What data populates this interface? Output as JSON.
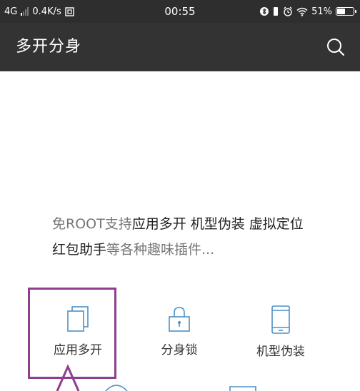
{
  "status_bar": {
    "network": "4G",
    "speed": "0.4K/s",
    "time": "00:55",
    "battery": "51%",
    "battery_level": 0.51,
    "icons": [
      "sim-icon",
      "bluetooth-icon",
      "vibrate-icon",
      "alarm-icon",
      "wifi-icon",
      "battery-icon"
    ]
  },
  "app_bar": {
    "title": "多开分身",
    "search_icon": "search-icon"
  },
  "description": {
    "segments": [
      "免ROOT支持",
      "应用多开 机型伪装 虚拟定位 红包助手",
      "等各种趣味插件..."
    ]
  },
  "features": [
    {
      "label": "应用多开",
      "icon": "copy-icon"
    },
    {
      "label": "分身锁",
      "icon": "lock-icon"
    },
    {
      "label": "机型伪装",
      "icon": "phone-icon"
    }
  ],
  "colors": {
    "status_bar_bg": "#2e2e2e",
    "app_bar_bg": "#333333",
    "icon_blue": "#4a90c8",
    "annotation_purple": "#8e3e8c",
    "text_muted": "#777777"
  }
}
